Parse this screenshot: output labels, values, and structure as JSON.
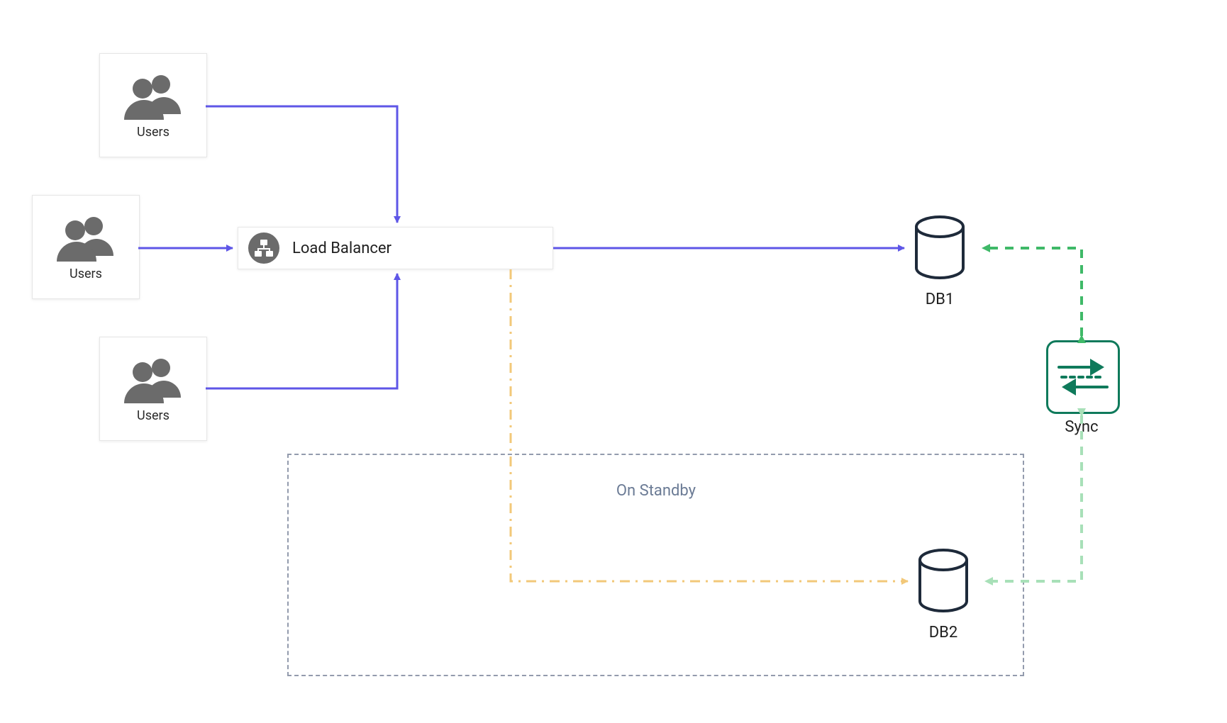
{
  "nodes": {
    "users1": {
      "label": "Users"
    },
    "users2": {
      "label": "Users"
    },
    "users3": {
      "label": "Users"
    },
    "load_balancer": {
      "label": "Load Balancer"
    },
    "db1": {
      "label": "DB1"
    },
    "db2": {
      "label": "DB2"
    },
    "sync": {
      "label": "Sync"
    }
  },
  "regions": {
    "standby": {
      "label": "On Standby"
    }
  },
  "colors": {
    "edge_primary": "#5E56E7",
    "edge_standby": "#F2C879",
    "edge_sync": "#3FB968",
    "edge_sync_weak": "#A8E0B8",
    "icon_gray": "#6B6B6B",
    "db_stroke": "#1E2A3A",
    "sync_stroke": "#0F7A5B"
  },
  "edges": [
    {
      "from": "users1",
      "to": "load_balancer",
      "style": "solid",
      "color": "edge_primary"
    },
    {
      "from": "users2",
      "to": "load_balancer",
      "style": "solid",
      "color": "edge_primary"
    },
    {
      "from": "users3",
      "to": "load_balancer",
      "style": "solid",
      "color": "edge_primary"
    },
    {
      "from": "load_balancer",
      "to": "db1",
      "style": "solid",
      "color": "edge_primary"
    },
    {
      "from": "load_balancer",
      "to": "db2",
      "style": "dashdot",
      "color": "edge_standby"
    },
    {
      "from": "sync",
      "to": "db1",
      "style": "dashed",
      "color": "edge_sync"
    },
    {
      "from": "sync",
      "to": "db2",
      "style": "dashed",
      "color": "edge_sync_weak"
    }
  ]
}
